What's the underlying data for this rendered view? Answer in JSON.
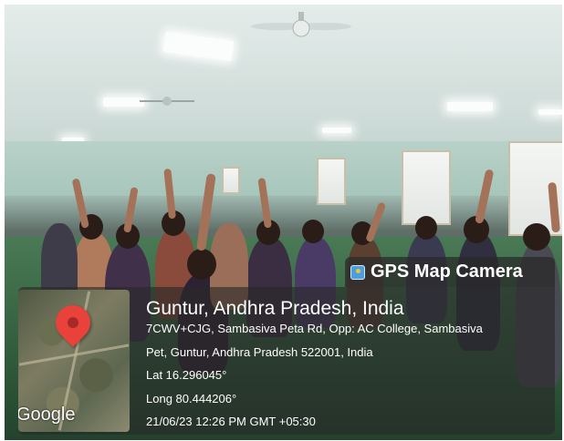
{
  "stamp": {
    "app_name": "GPS Map Camera",
    "app_icon": "gps-map-camera-icon",
    "location_title": "Guntur, Andhra Pradesh, India",
    "address_line1": "7CWV+CJG, Sambasiva Peta Rd, Opp: AC College, Sambasiva",
    "address_line2": "Pet, Guntur, Andhra Pradesh 522001, India",
    "latitude": "Lat 16.296045°",
    "longitude": "Long 80.444206°",
    "datetime": "21/06/23 12:26 PM GMT +05:30",
    "map_brand": "Google",
    "pin_color": "#e8423a"
  }
}
